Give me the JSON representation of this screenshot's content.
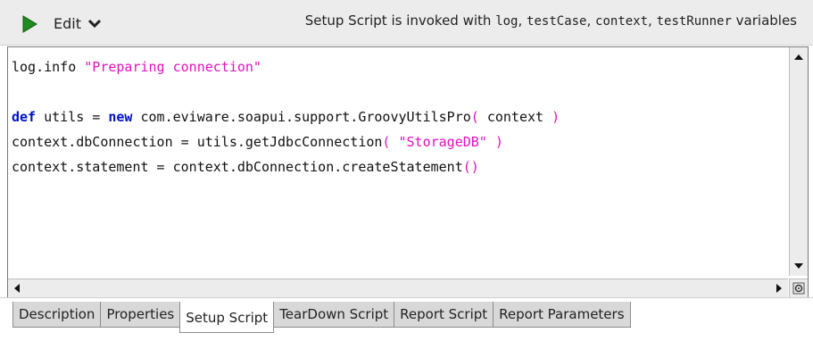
{
  "toolbar": {
    "run_icon": "play-icon",
    "edit_label": "Edit",
    "edit_icon": "chevron-down-icon",
    "hint_prefix": "Setup Script is invoked with ",
    "hint_vars": [
      {
        "name": "log",
        "sep": ", "
      },
      {
        "name": "testCase",
        "sep": ", "
      },
      {
        "name": "context",
        "sep": ", "
      },
      {
        "name": "testRunner",
        "sep": " "
      }
    ],
    "hint_suffix": "variables"
  },
  "editor": {
    "lines": [
      [
        {
          "t": "log.info ",
          "c": ""
        },
        {
          "t": "\"Preparing connection\"",
          "c": "str"
        }
      ],
      [
        {
          "t": "",
          "c": ""
        }
      ],
      [
        {
          "t": "def",
          "c": "kw"
        },
        {
          "t": " utils = ",
          "c": ""
        },
        {
          "t": "new",
          "c": "kw"
        },
        {
          "t": " com.eviware.soapui.support.GroovyUtilsPro",
          "c": ""
        },
        {
          "t": "(",
          "c": "paren"
        },
        {
          "t": " context ",
          "c": ""
        },
        {
          "t": ")",
          "c": "paren"
        }
      ],
      [
        {
          "t": "context.dbConnection = utils.getJdbcConnection",
          "c": ""
        },
        {
          "t": "(",
          "c": "paren"
        },
        {
          "t": " ",
          "c": ""
        },
        {
          "t": "\"StorageDB\"",
          "c": "str"
        },
        {
          "t": " ",
          "c": ""
        },
        {
          "t": ")",
          "c": "paren"
        }
      ],
      [
        {
          "t": "context.statement = context.dbConnection.createStatement",
          "c": ""
        },
        {
          "t": "()",
          "c": "paren"
        }
      ]
    ],
    "colors": {
      "keyword": "#0010c8",
      "string": "#e010c0"
    }
  },
  "tabs": [
    {
      "label": "Description",
      "active": false
    },
    {
      "label": "Properties",
      "active": false
    },
    {
      "label": "Setup Script",
      "active": true
    },
    {
      "label": "TearDown Script",
      "active": false
    },
    {
      "label": "Report Script",
      "active": false
    },
    {
      "label": "Report Parameters",
      "active": false
    }
  ]
}
